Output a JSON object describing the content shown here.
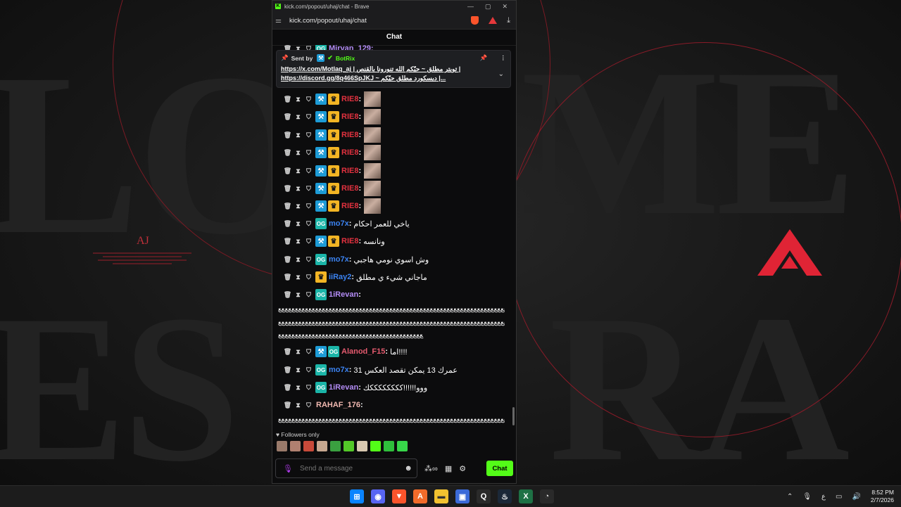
{
  "browser": {
    "window_title": "kick.com/popout/uhaj/chat - Brave",
    "url": "kick.com/popout/uhaj/chat",
    "brave_shield_count": "6"
  },
  "chat": {
    "header": "Chat",
    "partial_top_name": "Mirvan_129:",
    "pinned": {
      "sent_by_label": "Sent by",
      "bot_name": "BotRix",
      "line1": "https://x.com/Motlaq_aj | تويتر مطلق ~ حيّكم الله تنورونا بالقنص |",
      "line2": "https://discord.gg/8q466SpJKJ ~ ديسكورد مطلق حيّكم |..."
    },
    "messages": [
      {
        "user": "RIE8",
        "color": "#e2313f",
        "text": "",
        "badges": [
          "mod",
          "sub"
        ],
        "emote": true
      },
      {
        "user": "RIE8",
        "color": "#e2313f",
        "text": "",
        "badges": [
          "mod",
          "sub"
        ],
        "emote": true
      },
      {
        "user": "RIE8",
        "color": "#e2313f",
        "text": "",
        "badges": [
          "mod",
          "sub"
        ],
        "emote": true
      },
      {
        "user": "RIE8",
        "color": "#e2313f",
        "text": "",
        "badges": [
          "mod",
          "sub"
        ],
        "emote": true
      },
      {
        "user": "RIE8",
        "color": "#e2313f",
        "text": "",
        "badges": [
          "mod",
          "sub"
        ],
        "emote": true
      },
      {
        "user": "RIE8",
        "color": "#e2313f",
        "text": "",
        "badges": [
          "mod",
          "sub"
        ],
        "emote": true
      },
      {
        "user": "RIE8",
        "color": "#e2313f",
        "text": "",
        "badges": [
          "mod",
          "sub"
        ],
        "emote": true
      },
      {
        "user": "mo7x",
        "color": "#3b82f0",
        "text": "ياخي للعمر احكام",
        "badges": [
          "og"
        ],
        "emote": false
      },
      {
        "user": "RIE8",
        "color": "#e2313f",
        "text": "ونانسه",
        "badges": [
          "mod",
          "sub"
        ],
        "emote": false
      },
      {
        "user": "mo7x",
        "color": "#3b82f0",
        "text": "وش اسوي نومي هاجبي",
        "badges": [
          "og"
        ],
        "emote": false
      },
      {
        "user": "iiRay2",
        "color": "#3b82f0",
        "text": "ماجاني شيء ي مطلق",
        "badges": [
          "sub"
        ],
        "emote": false
      },
      {
        "user": "1iRevan",
        "color": "#b38cf5",
        "text": "",
        "badges": [
          "og"
        ],
        "emote": false
      },
      {
        "user": "Alanod_F15",
        "color": "#e55a6e",
        "text": "اما!!!!",
        "badges": [
          "mod",
          "og"
        ],
        "emote": false
      },
      {
        "user": "mo7x",
        "color": "#3b82f0",
        "text": "عمرك 13 يمكن تقصد العكس 31",
        "badges": [
          "og"
        ],
        "emote": false
      },
      {
        "user": "1iRevan",
        "color": "#b38cf5",
        "text": "ووو!!!!!!ككككككككك",
        "badges": [
          "og"
        ],
        "emote": false
      },
      {
        "user": "RAHAF_176",
        "color": "#f0b8b0",
        "text": "",
        "badges": [],
        "emote": false
      }
    ],
    "revan_long_1": "ﻊﻊﻊﻊﻊﻊﻊﻊﻊﻊﻊﻊﻊﻊﻊﻊﻊﻊﻊﻊﻊﻊﻊﻊﻊﻊﻊﻊﻊﻊﻊﻊﻊﻊﻊﻊﻊﻊﻊﻊﻊﻊﻊﻊﻊﻊﻊﻊﻊﻊﻊﻊﻊﻊﻊﻊﻊﻊﻊﻊﻊﻊﻊﻊﻊﻊﻊﻊﻊﻊﻊﻊﻊﻊﻊﻊﻊﻊﻊﻊﻊﻊﻊﻊﻊﻊﻊﻊﻊﻊﻊﻊﻊﻊﻊﻊﻊﻊﻊﻊﻊﻊﻊﻊﻊﻊﻊﻊﻊﻊﻊﻊﻊﻊﻊﻊﻊﻊﻊﻊﻊﻊﻊﻊﻊﻊﻊﻊﻊ",
    "revan_long_2": "ﻊﻊﻊﻊﻊﻊﻊﻊﻊﻊﻊﻊﻊﻊﻊﻊﻊﻊﻊﻊﻊﻊﻊﻊﻊﻊﻊﻊﻊﻊﻊﻊﻊﻊﻊﻊﻊﻊﻊﻊﻊﻊﻊﻊﻊﻊﻊﻊﻊﻊﻊﻊﻊﻊﻊﻊﻊﻊﻊﻊﻊﻊﻊﻊﻊﻊﻊﻊﻊﻊﻊﻊﻊﻊﻊﻊﻊﻊﻊﻊﻊﻊﻊﻊﻊﻊﻊﻊﻊﻊﻊﻊﻊﻊﻊﻊﻊﻊﻊﻊﻊﻊﻊﻊﻊﻊﻊﻊﻊﻊﻊﻊﻊﻊﻊﻊﻊﻊﻊﻊﻊﻊﻊﻊﻊﻊﻊﻊﻊ",
    "revan_long_3": "ﻊﻊﻊﻊﻊﻊﻊﻊﻊﻊﻊﻊﻊﻊﻊﻊﻊﻊﻊﻊﻊﻊﻊﻊﻊﻊﻊﻊﻊﻊﻊﻊﻊﻊﻊﻊﻊﻊﻊﻊﻊﻊﻊ",
    "rahaf_long": "ﻊﻊﻊﻊﻊﻊﻊﻊﻊﻊﻊﻊﻊﻊﻊﻊﻊﻊﻊﻊﻊﻊﻊﻊﻊﻊﻊﻊﻊﻊﻊﻊﻊﻊﻊﻊﻊﻊﻊﻊﻊﻊﻊﻊﻊﻊﻊﻊﻊﻊﻊﻊﻊﻊﻊﻊﻊﻊﻊﻊﻊﻊﻊﻊﻊﻊﻊﻊﻊﻊﻊﻊﻊﻊﻊﻊﻊﻊﻊﻊﻊﻊﻊﻊﻊﻊﻊﻊﻊﻊﻊﻊﻊﻊﻊﻊﻊﻊ",
    "followers_only": "Followers only",
    "input_placeholder": "Send a message",
    "send_label": "Chat"
  },
  "wallpaper": {
    "aj_text": "AJ"
  },
  "taskbar": {
    "time": "8:52 PM",
    "date": "2/7/2026",
    "lang": "ع"
  },
  "colors": {
    "kick_green": "#53fc18",
    "accent_red": "#e02435"
  }
}
